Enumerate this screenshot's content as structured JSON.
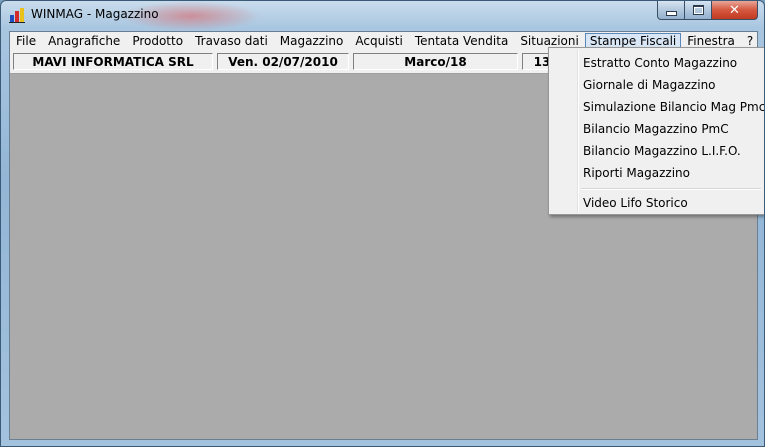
{
  "window": {
    "title": "WINMAG - Magazzino",
    "close_glyph": "✕"
  },
  "menubar": {
    "items": [
      "File",
      "Anagrafiche",
      "Prodotto",
      "Travaso dati",
      "Magazzino",
      "Acquisti",
      "Tentata Vendita",
      "Situazioni",
      "Stampe Fiscali",
      "Finestra",
      "?"
    ],
    "active": "Stampe Fiscali"
  },
  "status": {
    "company": "MAVI INFORMATICA SRL",
    "date": "Ven. 02/07/2010",
    "user": "Marco/18",
    "partial": "13"
  },
  "dropdown": {
    "items": [
      "Estratto Conto Magazzino",
      "Giornale di Magazzino",
      "Simulazione Bilancio Mag Pmc",
      "Bilancio Magazzino PmC",
      "Bilancio Magazzino L.I.F.O.",
      "Riporti Magazzino",
      "Video Lifo Storico"
    ]
  },
  "colors": {
    "mdi_background": "#ababab",
    "menu_background": "#f0f0f0",
    "active_menu_highlight": "#d8e6f5",
    "close_button": "#c13a20"
  },
  "icons": {
    "app": "winmag-app-icon",
    "minimize": "minimize-icon",
    "maximize": "maximize-icon",
    "close": "close-icon"
  }
}
